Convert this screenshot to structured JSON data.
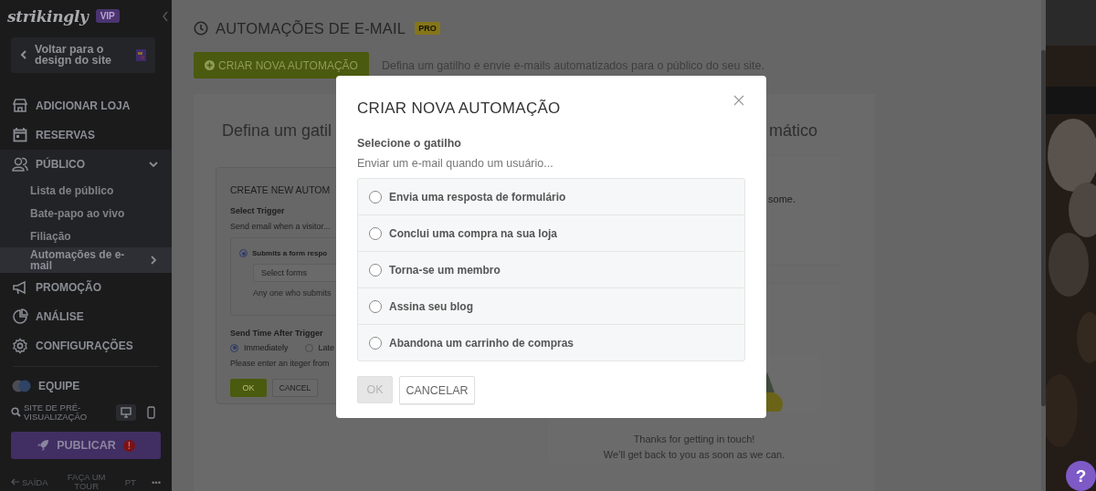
{
  "sidebar": {
    "logo": "strikingly",
    "badge": "VIP",
    "back_button": "Voltar para o design do site",
    "nav": [
      {
        "label": "ADICIONAR LOJA"
      },
      {
        "label": "RESERVAS"
      },
      {
        "label": "PÚBLICO",
        "expanded": true,
        "children": [
          {
            "label": "Lista de público",
            "selected": false
          },
          {
            "label": "Bate-papo ao vivo",
            "selected": false
          },
          {
            "label": "Filiação",
            "selected": false
          },
          {
            "label": "Automações de e-mail",
            "selected": true
          }
        ]
      },
      {
        "label": "PROMOÇÃO"
      },
      {
        "label": "ANÁLISE"
      },
      {
        "label": "CONFIGURAÇÕES"
      }
    ],
    "team": "EQUIPE",
    "preview": {
      "label": "SITE DE PRÉ-VISUALIZAÇÃO",
      "devices": [
        {
          "kind": "desktop",
          "selected": true
        },
        {
          "kind": "mobile",
          "selected": false
        }
      ]
    },
    "publish": {
      "label": "PUBLICAR",
      "alert": "!"
    },
    "footer": {
      "exit": "SAÍDA",
      "tour": "FAÇA UM TOUR",
      "language": "PT",
      "more": "•••"
    }
  },
  "page": {
    "title": "AUTOMAÇÕES DE E-MAIL",
    "badge": "PRO",
    "create_button": "CRIAR NOVA AUTOMAÇÃO",
    "description": "Defina um gatilho e envie e-mails automatizados para o público do seu site.",
    "heading_left": "Defina um gatil",
    "heading_right": "mático",
    "editor": {
      "title": "CREATE NEW AUTOM",
      "trigger_label": "Select Trigger",
      "trigger_hint": "Send email when a visitor...",
      "trigger_option": {
        "label": "Submits a form respo",
        "selected": true
      },
      "forms_placeholder": "Select forms",
      "forms_hint": "Any one who submits",
      "send_time_label": "Send Time After Trigger",
      "send_time_options": [
        {
          "label": "Immediately",
          "selected": true
        },
        {
          "label": "Late",
          "selected": false
        }
      ],
      "send_time_hint": "Please enter an iteger  from",
      "ok": "OK",
      "cancel": "CANCEL"
    },
    "preview_text": "some.",
    "thanks_lines": [
      "Thanks for getting in touch!",
      "We’ll get back to you as soon as we can."
    ]
  },
  "modal": {
    "title": "CRIAR NOVA AUTOMAÇÃO",
    "label": "Selecione o gatilho",
    "hint": "Enviar um e-mail quando um usuário...",
    "options": [
      {
        "label": "Envia uma resposta de formulário",
        "selected": false
      },
      {
        "label": "Conclui uma compra na sua loja",
        "selected": false
      },
      {
        "label": "Torna-se um membro",
        "selected": false
      },
      {
        "label": "Assina seu blog",
        "selected": false
      },
      {
        "label": "Abandona um carrinho de compras",
        "selected": false
      }
    ],
    "ok": {
      "label": "OK",
      "disabled": true
    },
    "cancel": "CANCELAR"
  },
  "help": "?"
}
